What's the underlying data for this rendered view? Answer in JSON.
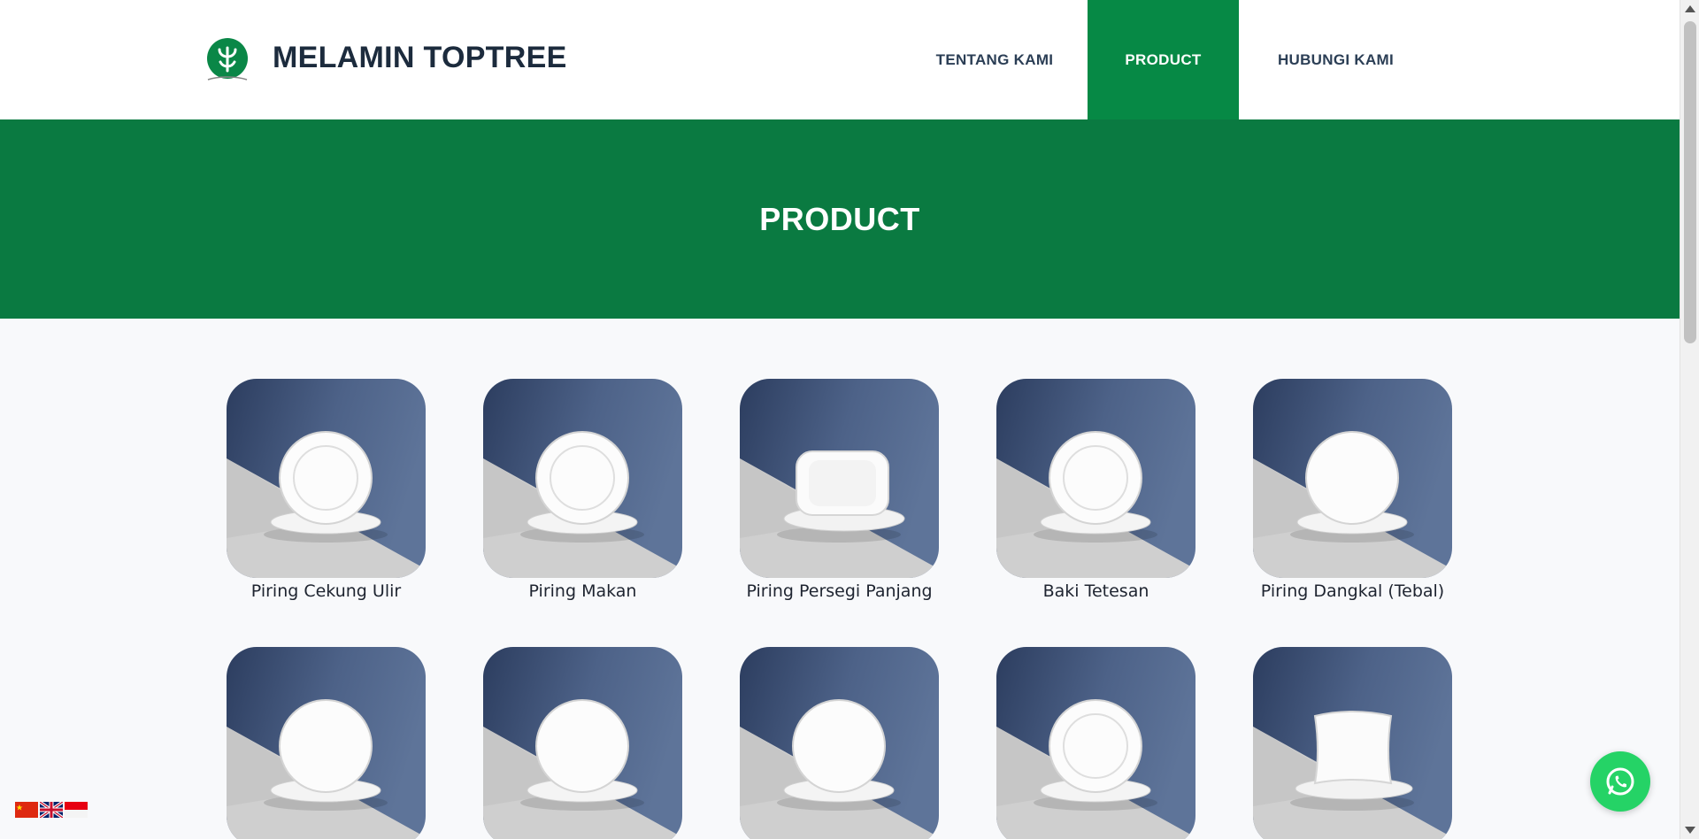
{
  "header": {
    "brand": "MELAMIN TOPTREE",
    "nav": [
      {
        "label": "TENTANG KAMI",
        "active": false
      },
      {
        "label": "PRODUCT",
        "active": true
      },
      {
        "label": "HUBUNGI KAMI",
        "active": false
      }
    ]
  },
  "banner": {
    "title": "PRODUCT"
  },
  "products": [
    {
      "name": "Piring Cekung Ulir",
      "shape": "deep-plate"
    },
    {
      "name": "Piring Makan",
      "shape": "deep-plate"
    },
    {
      "name": "Piring Persegi Panjang",
      "shape": "rect-plate"
    },
    {
      "name": "Baki Tetesan",
      "shape": "deep-plate"
    },
    {
      "name": "Piring Dangkal (Tebal)",
      "shape": "flat-plate"
    },
    {
      "name": "",
      "shape": "flat-plate"
    },
    {
      "name": "",
      "shape": "flat-plate"
    },
    {
      "name": "",
      "shape": "flat-plate"
    },
    {
      "name": "",
      "shape": "deep-plate"
    },
    {
      "name": "",
      "shape": "square-plate"
    }
  ],
  "languages": [
    "zh-CN",
    "en",
    "id"
  ],
  "colors": {
    "brand_green": "#068945",
    "banner_green": "#0a7a41",
    "text_dark": "#1c2b3d",
    "whatsapp": "#25d366"
  },
  "icons": {
    "logo": "toptree-logo-icon",
    "whatsapp": "whatsapp-icon"
  }
}
